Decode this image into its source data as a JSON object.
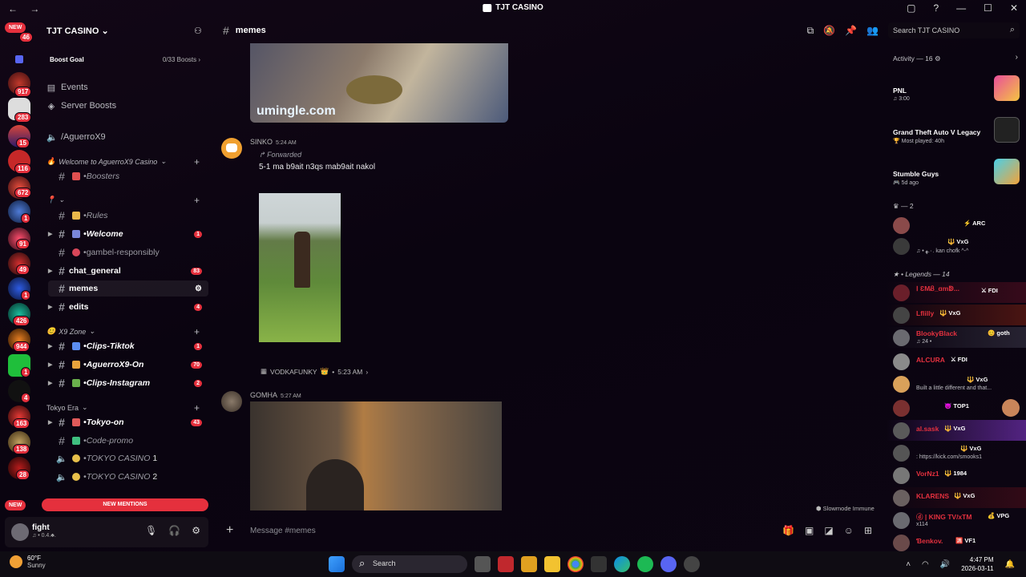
{
  "window": {
    "title": "TJT CASINO",
    "nav": "← →"
  },
  "rail": {
    "new_top": "NEW",
    "new_bottom": "NEW",
    "badges": [
      "46",
      "917",
      "283",
      "15",
      "116",
      "672",
      "1",
      "91",
      "49",
      "1",
      "426",
      "944",
      "1",
      "4",
      "163",
      "138",
      "28"
    ]
  },
  "sidebar": {
    "server_name": "TJT CASINO",
    "boost_goal": "Boost Goal",
    "boost_count": "0/33 Boosts",
    "events": "Events",
    "server_boosts": "Server Boosts",
    "aguerro_link": "/AguerroX9",
    "category_welcome": "Welcome to AguerroX9 Casino",
    "boosters": "Boosters",
    "rules": "Rules",
    "welcome": "Welcome",
    "welcome_count": "1",
    "gambel": "gambel-responsibly",
    "chat_general": "chat_general",
    "chat_general_count": "83",
    "memes": "memes",
    "edits": "edits",
    "edits_count": "4",
    "category_x9": "X9 Zone",
    "clips_tiktok": "Clips-Tiktok",
    "clips_tiktok_count": "1",
    "aguerro_on": "AguerroX9-On",
    "aguerro_on_count": "70",
    "clips_instagram": "Clips-Instagram",
    "clips_instagram_count": "2",
    "category_tokyo": "Tokyo Era",
    "tokyo_on": "Tokyo-on",
    "tokyo_on_count": "43",
    "code_promo": "Code-promo",
    "tokyo_casino_1": "TOKYO CASINO",
    "tokyo_casino_1_num": "1",
    "tokyo_casino_2": "TOKYO CASINO",
    "tokyo_casino_2_num": "2",
    "new_mentions": "NEW MENTIONS"
  },
  "user": {
    "name": "fight",
    "status": "♫ • 0.4.♣."
  },
  "chat": {
    "channel": "memes",
    "image1_watermark": "umingle.com",
    "msg2_author": "SINKO",
    "msg2_time": "5:24 AM",
    "msg2_forwarded": "Forwarded",
    "msg2_text": "5-1 ma b9ait n3qs mab9ait nakol",
    "msg2_source": "VODKAFUNKY",
    "msg2_source_time": "5:23 AM",
    "msg3_author": "GOMHA",
    "msg3_time": "5:27 AM",
    "composer_placeholder": "Message #memes",
    "slowmode": "Slowmode Immune"
  },
  "search": {
    "placeholder": "Search TJT CASINO"
  },
  "members": {
    "activity_header": "Activity — 16",
    "activities": [
      {
        "name": "PNL",
        "sub": "♫ 3:00"
      },
      {
        "name": "Grand Theft Auto V Legacy",
        "sub": "🏆 Most played: 40h"
      },
      {
        "name": "Stumble Guys",
        "sub": "🎮 5d ago"
      }
    ],
    "group2_header": "♛ — 2",
    "group2": [
      {
        "name": "",
        "tag": "⚡ ARC",
        "sub": ""
      },
      {
        "name": "",
        "tag": "🔱 VxG",
        "sub": "♫ • ٠.ﻬ. kan chofk ^-^"
      }
    ],
    "legends_header": "Legends — 14",
    "legends": [
      {
        "name": "Ⅰ ƐMᏰ_ɑmↁ...",
        "tag": "⚔ FDI",
        "sub": ""
      },
      {
        "name": "Lflilly",
        "tag": "🔱 VxG",
        "sub": ""
      },
      {
        "name": "BlookyBlack",
        "tag": "😊 goth",
        "sub": "♫ 24 •"
      },
      {
        "name": "ALCURA",
        "tag": "⚔ FDI",
        "sub": ""
      },
      {
        "name": "",
        "tag": "🔱 VxG",
        "sub": "Built a little different and that..."
      },
      {
        "name": "",
        "tag": "😈 TOP1",
        "sub": ""
      },
      {
        "name": "al.sask",
        "tag": "🔱 VxG",
        "sub": ""
      },
      {
        "name": "",
        "tag": "🔱 VxG",
        "sub": ": https://kick.com/smooks1"
      },
      {
        "name": "VorNz1",
        "tag": "🔱 1984",
        "sub": ""
      },
      {
        "name": "KLARENS",
        "tag": "🔱 VxG",
        "sub": ""
      },
      {
        "name": "ⓓ | KING TV/xTM",
        "tag": "💰 VPG",
        "sub": "x114"
      },
      {
        "name": "Ɓenkov.",
        "tag": "🈵 VF1",
        "sub": ""
      }
    ]
  },
  "taskbar": {
    "temp": "60°F",
    "weather": "Sunny",
    "search": "Search",
    "time": "4:47 PM",
    "date": "2026-03-11"
  },
  "colors": {
    "accent_red": "#e5303d",
    "background": "#0b0410"
  }
}
